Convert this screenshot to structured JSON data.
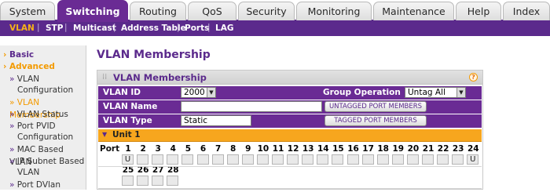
{
  "top_tabs": [
    {
      "label": "System",
      "active": false
    },
    {
      "label": "Switching",
      "active": true
    },
    {
      "label": "Routing",
      "active": false
    },
    {
      "label": "QoS",
      "active": false
    },
    {
      "label": "Security",
      "active": false
    },
    {
      "label": "Monitoring",
      "active": false
    },
    {
      "label": "Maintenance",
      "active": false
    },
    {
      "label": "Help",
      "active": false
    },
    {
      "label": "Index",
      "active": false
    }
  ],
  "subnav": [
    {
      "label": "VLAN",
      "active": true
    },
    {
      "label": "STP",
      "active": false
    },
    {
      "label": "Multicast",
      "active": false
    },
    {
      "label": "Address Table",
      "active": false
    },
    {
      "label": "Ports",
      "active": false
    },
    {
      "label": "LAG",
      "active": false
    }
  ],
  "sidebar": {
    "basic": "Basic",
    "advanced": "Advanced",
    "items": [
      {
        "label": "VLAN",
        "cont": "Configuration",
        "active": false
      },
      {
        "label": "VLAN Membership",
        "active": true
      },
      {
        "label": "VLAN Status",
        "active": false
      },
      {
        "label": "Port PVID",
        "cont": "Configuration",
        "active": false
      },
      {
        "label": "MAC Based VLAN",
        "active": false
      },
      {
        "label": "IP Subnet Based",
        "cont": "VLAN",
        "active": false
      },
      {
        "label": "Port DVlan",
        "active": false
      }
    ]
  },
  "page_title": "VLAN Membership",
  "panel": {
    "title": "VLAN Membership",
    "help_symbol": "?",
    "vlan_id_label": "VLAN ID",
    "vlan_id_value": "2000",
    "group_operation_label": "Group Operation",
    "group_operation_value": "Untag All",
    "vlan_name_label": "VLAN Name",
    "vlan_name_value": "",
    "vlan_type_label": "VLAN Type",
    "vlan_type_value": "Static",
    "untagged_button": "UNTAGGED PORT MEMBERS",
    "tagged_button": "TAGGED PORT MEMBERS",
    "unit_label": "Unit 1",
    "port_label": "Port",
    "ports_row1": [
      "1",
      "2",
      "3",
      "4",
      "5",
      "6",
      "7",
      "8",
      "9",
      "10",
      "11",
      "12",
      "13",
      "14",
      "15",
      "16",
      "17",
      "18",
      "19",
      "20",
      "21",
      "22",
      "23",
      "24"
    ],
    "states_row1": [
      "U",
      "",
      "",
      "",
      "",
      "",
      "",
      "",
      "",
      "",
      "",
      "",
      "",
      "",
      "",
      "",
      "",
      "",
      "",
      "",
      "",
      "",
      "",
      "U"
    ],
    "ports_row2": [
      "25",
      "26",
      "27",
      "28"
    ],
    "states_row2": [
      "",
      "",
      "",
      ""
    ]
  }
}
